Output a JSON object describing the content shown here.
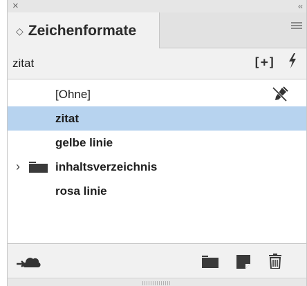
{
  "window": {
    "close_glyph": "×",
    "collapse_glyph": "‹‹"
  },
  "tab": {
    "updown_glyph": "◇",
    "label": "Zeichenformate"
  },
  "current": {
    "name": "zitat",
    "new_style_glyph": "[+]",
    "quick_apply_glyph": "ϟ"
  },
  "styles": [
    {
      "label": "[Ohne]",
      "selected": false,
      "icon": "pen-crossed-icon"
    },
    {
      "label": "zitat",
      "selected": true
    },
    {
      "label": "gelbe linie",
      "selected": false
    },
    {
      "label": "inhaltsverzeichnis",
      "selected": false,
      "group": true,
      "expand_glyph": "›"
    },
    {
      "label": "rosa linie",
      "selected": false
    }
  ],
  "footer": {
    "icons": [
      "cloud-sync-icon",
      "new-group-icon",
      "new-style-icon",
      "trash-icon"
    ]
  },
  "colors": {
    "selection": "#b7d3ef",
    "panel_bg": "#f1f1f1"
  }
}
